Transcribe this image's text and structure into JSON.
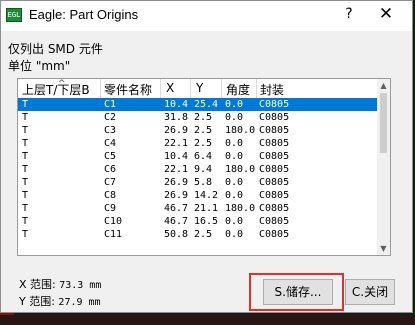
{
  "window": {
    "title": "Eagle: Part Origins",
    "help_glyph": "?",
    "close_glyph": "✕",
    "app_icon_text": "EGL"
  },
  "info": {
    "line1": "仅列出 SMD 元件",
    "line2": "单位 \"mm\""
  },
  "table": {
    "headers": [
      "上层T/下层B",
      "零件名称",
      "X",
      "Y",
      "角度",
      "封装"
    ],
    "selected_row": 0,
    "rows": [
      [
        "T",
        "C1",
        "10.4",
        "25.4",
        "0.0",
        "C0805"
      ],
      [
        "T",
        "C2",
        "31.8",
        "2.5",
        "0.0",
        "C0805"
      ],
      [
        "T",
        "C3",
        "26.9",
        "2.5",
        "180.0",
        "C0805"
      ],
      [
        "T",
        "C4",
        "22.1",
        "2.5",
        "0.0",
        "C0805"
      ],
      [
        "T",
        "C5",
        "10.4",
        "6.4",
        "0.0",
        "C0805"
      ],
      [
        "T",
        "C6",
        "22.1",
        "9.4",
        "180.0",
        "C0805"
      ],
      [
        "T",
        "C7",
        "26.9",
        "5.8",
        "0.0",
        "C0805"
      ],
      [
        "T",
        "C8",
        "26.9",
        "14.2",
        "0.0",
        "C0805"
      ],
      [
        "T",
        "C9",
        "46.7",
        "21.1",
        "180.0",
        "C0805"
      ],
      [
        "T",
        "C10",
        "46.7",
        "16.5",
        "0.0",
        "C0805"
      ],
      [
        "T",
        "C11",
        "50.8",
        "2.5",
        "0.0",
        "C0805"
      ]
    ]
  },
  "ranges": {
    "x_label": "X 范围:",
    "x_value": "73.3 mm",
    "y_label": "Y 范围:",
    "y_value": "27.9 mm"
  },
  "buttons": {
    "save_label": "S.储存...",
    "close_label": "C.关闭"
  },
  "colors": {
    "selection": "#0078d7",
    "highlight_box": "#e03030",
    "app_icon": "#1f8a3b"
  }
}
